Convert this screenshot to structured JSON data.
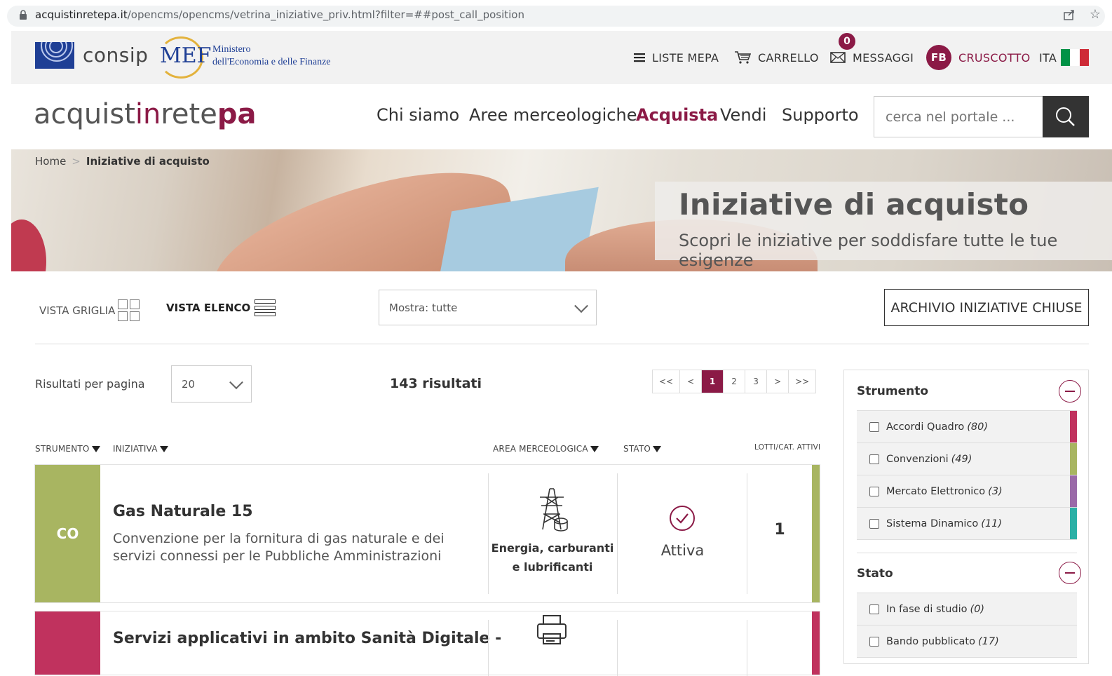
{
  "browser": {
    "url_host": "acquistinretepa.it",
    "url_path": "/opencms/opencms/vetrina_iniziative_priv.html?filter=##post_call_position"
  },
  "topbar": {
    "consip": "consip",
    "mef": "MEF",
    "mef_line1": "Ministero",
    "mef_line2": "dell'Economia e delle Finanze",
    "liste_mepa": "LISTE MEPA",
    "carrello": "CARRELLO",
    "messaggi": "MESSAGGI",
    "messaggi_count": "0",
    "user_initials": "FB",
    "cruscotto": "CRUSCOTTO",
    "lang": "ITA",
    "flag_colors": [
      "#009246",
      "#ffffff",
      "#ce2b37"
    ]
  },
  "header": {
    "brand_a": "acquist",
    "brand_b": "in",
    "brand_c": "rete",
    "brand_d": "pa",
    "nav": [
      "Chi siamo",
      "Aree merceologiche",
      "Acquista",
      "Vendi",
      "Supporto"
    ],
    "active_nav": "Acquista",
    "search_placeholder": "cerca nel portale ..."
  },
  "hero": {
    "breadcrumb_home": "Home",
    "breadcrumb_sep": ">",
    "breadcrumb_current": "Iniziative di acquisto",
    "title": "Iniziative di acquisto",
    "subtitle": "Scopri le iniziative per soddisfare tutte le tue esigenze"
  },
  "controls": {
    "vista_griglia": "VISTA GRIGLIA",
    "vista_elenco": "VISTA ELENCO",
    "mostra": "Mostra: tutte",
    "archivio": "ARCHIVIO INIZIATIVE CHIUSE",
    "rpp_label": "Risultati per pagina",
    "rpp_value": "20",
    "results": "143 risultati",
    "pager": [
      "<<",
      "<",
      "1",
      "2",
      "3",
      ">",
      ">>"
    ],
    "current_page": "1"
  },
  "table": {
    "headers": {
      "strumento": "STRUMENTO",
      "iniziativa": "INIZIATIVA",
      "area": "AREA MERCEOLOGICA",
      "stato": "STATO",
      "lotti": "LOTTI/CAT. ATTIVI"
    },
    "rows": [
      {
        "code": "CO",
        "color": "#a8b561",
        "title": "Gas Naturale 15",
        "desc": "Convenzione per la fornitura di gas naturale e dei servizi connessi per le Pubbliche Amministrazioni",
        "area_l1": "Energia, carburanti",
        "area_l2": "e lubrificanti",
        "area_icon": "power-tower-icon",
        "stato": "Attiva",
        "lotti": "1"
      },
      {
        "code": "",
        "color": "#c0325e",
        "title": "Servizi applicativi in ambito Sanità Digitale -",
        "area_icon": "printer-icon"
      }
    ]
  },
  "filters": {
    "strumento_title": "Strumento",
    "strumento": [
      {
        "label": "Accordi Quadro",
        "count": "(80)",
        "color": "#c0325e"
      },
      {
        "label": "Convenzioni",
        "count": "(49)",
        "color": "#a8b561"
      },
      {
        "label": "Mercato Elettronico",
        "count": "(3)",
        "color": "#9a6aa8"
      },
      {
        "label": "Sistema Dinamico",
        "count": "(11)",
        "color": "#2ab0a6"
      }
    ],
    "stato_title": "Stato",
    "stato": [
      {
        "label": "In fase di studio",
        "count": "(0)"
      },
      {
        "label": "Bando pubblicato",
        "count": "(17)"
      }
    ]
  },
  "colors": {
    "accent": "#8b1a46"
  }
}
